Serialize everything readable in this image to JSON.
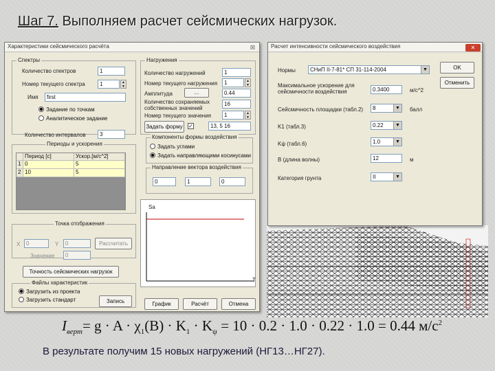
{
  "slide": {
    "title_step": "Шаг 7.",
    "title_rest": " Выполняем расчет сейсмических нагрузок.",
    "formula": {
      "lhs_main": "I",
      "lhs_sub": "верт",
      "expr_a": "= g · A · χ",
      "chi_sub": "1",
      "expr_b": "(B) · K",
      "k_sub": "1",
      "expr_c": " · K",
      "kpsi_sub": "ψ",
      "expr_d": " = 10 · 0.2 · 1.0 · 0.22 · 1.0 = 0.44 м/с",
      "unit_sup": "2"
    },
    "result": "В результате получим 15 новых нагружений (НГ13…НГ27)."
  },
  "left_dialog": {
    "title": "Характеристики сейсмического расчёта",
    "close": "☒",
    "spectra": {
      "legend": "Спектры",
      "count_label": "Количество спектров",
      "count_value": "1",
      "current_label": "Номер текущего спектра",
      "current_value": "1",
      "name_label": "Имя",
      "name_value": "first",
      "radio_points": "Задание по точкам",
      "radio_analytic": "Аналитическое задание",
      "intervals_label": "Количество интервалов",
      "intervals_value": "3"
    },
    "periods": {
      "legend": "Периоды и ускорения",
      "col_period": "Период [с]",
      "col_accel": "Ускор.[м/с^2]",
      "rows": [
        {
          "n": "1",
          "period": "0",
          "accel": "5"
        },
        {
          "n": "2",
          "period": "10",
          "accel": "5"
        }
      ]
    },
    "loads": {
      "legend": "Нагружения",
      "count_label": "Количество нагружений",
      "count_value": "1",
      "current_label": "Номер текущего нагружения",
      "current_value": "1",
      "amplitude_label": "Амплитуда",
      "amplitude_btn": "...",
      "amplitude_value": "0.44",
      "saved_count_label": "Количество сохраняемых собственных значений",
      "saved_count_value": "16",
      "current_value_label": "Номер текущего значения",
      "current_value_value": "1",
      "assign_btn": "Задать форму",
      "assign_checked": "✓",
      "assign_value": "13, 5 16"
    },
    "components": {
      "legend": "Компоненты формы воздействия",
      "radio_angles": "Задать углами",
      "radio_cosines": "Задать направляющими косинусами"
    },
    "direction": {
      "legend": "Направление вектора воздействия",
      "x": "0",
      "y": "1",
      "z": "0"
    },
    "graph": {
      "y_label": "Sa",
      "x_label": "T"
    },
    "response": {
      "legend": "Точка отображения",
      "x_label": "X",
      "x_value": "0",
      "y_label": "Y",
      "y_value": "0",
      "calc_btn": "Рассчитать",
      "value_label": "Значение",
      "value_value": "0"
    },
    "accuracy_btn": "Точность сейсмических нагрузок",
    "files": {
      "legend": "Файлы характеристик",
      "radio_load": "Загрузить из проекта",
      "radio_standard": "Загрузить стандарт",
      "save_btn": "Запись"
    },
    "graph_btn": "График",
    "calc_btn": "Расчёт",
    "cancel_btn": "Отмена"
  },
  "right_dialog": {
    "title": "Расчет интенсивности сейсмического воздействия",
    "close": "✕",
    "norms_label": "Нормы",
    "norms_value": "СНиП II-7-81* СП 31-114-2004",
    "ok_btn": "OK",
    "cancel_btn": "Отменить",
    "accel_label": "Максимальное ускорение для сейсмичности воздействия",
    "accel_value": "0.3400",
    "accel_unit": "м/с^2",
    "seismic_label": "Сейсмичность площадки (табл.2)",
    "seismic_value": "8",
    "seismic_unit": "балл",
    "k1_label": "K1 (табл.3)",
    "k1_value": "0.22",
    "kpsi_label": "Kψ (табл.6)",
    "kpsi_value": "1.0",
    "b_label": "B (длина волны)",
    "b_value": "12",
    "b_unit": "м",
    "soil_label": "Категория грунта",
    "soil_value": "II"
  }
}
